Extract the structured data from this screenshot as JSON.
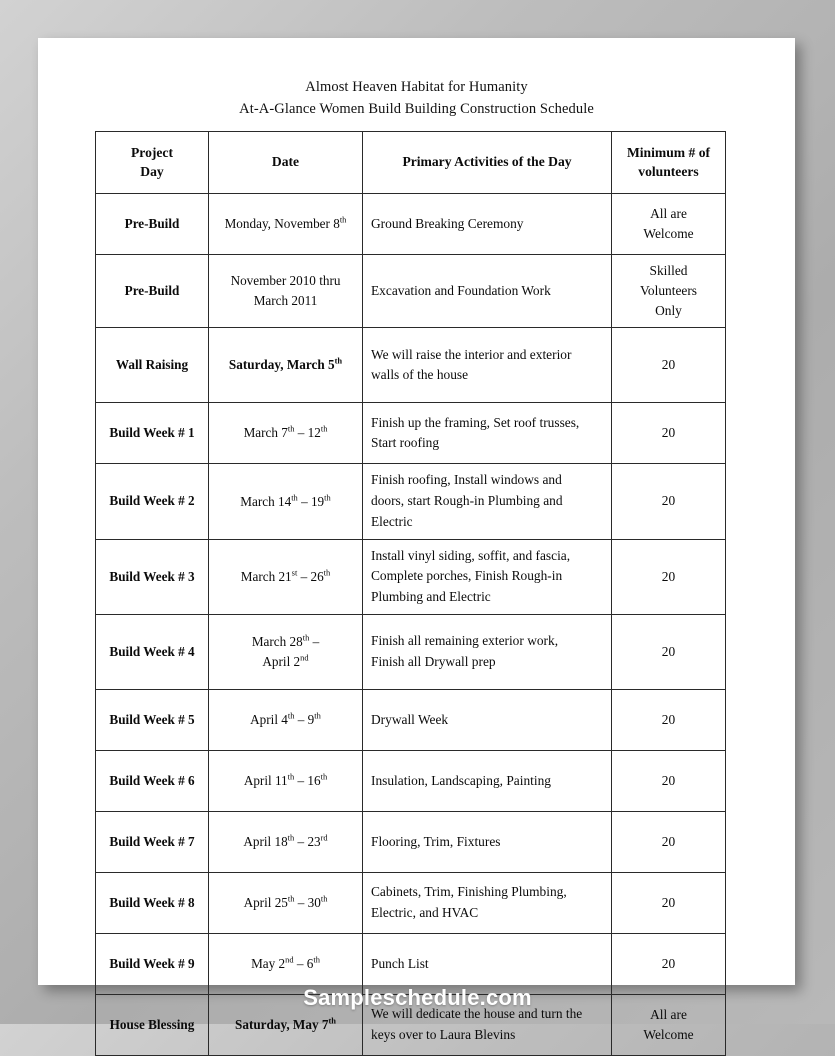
{
  "document": {
    "title_line1": "Almost Heaven Habitat for Humanity",
    "title_line2": "At-A-Glance Women Build Building Construction Schedule"
  },
  "table": {
    "headers": {
      "day": "Project\nDay",
      "day_line1": "Project",
      "day_line2": "Day",
      "date": "Date",
      "activities": "Primary Activities of the Day",
      "volunteers_line1": "Minimum # of",
      "volunteers_line2": "volunteers"
    },
    "rows": [
      {
        "day": "Pre-Build",
        "date_html": "Monday, November 8<sup>th</sup>",
        "date_bold": false,
        "activity_lines": [
          "Ground Breaking Ceremony"
        ],
        "volunteers_lines": [
          "All are",
          "Welcome"
        ]
      },
      {
        "day": "Pre-Build",
        "date_html": "November 2010 thru<br>March 2011",
        "date_bold": false,
        "activity_lines": [
          "Excavation and Foundation Work"
        ],
        "volunteers_lines": [
          "Skilled",
          "Volunteers",
          "Only"
        ]
      },
      {
        "day": "Wall Raising",
        "date_html": "Saturday, March 5<sup>th</sup>",
        "date_bold": true,
        "activity_lines": [
          "We will raise the interior and exterior",
          "walls of the house"
        ],
        "volunteers_lines": [
          "20"
        ]
      },
      {
        "day": "Build Week # 1",
        "date_html": "March 7<sup>th</sup> &ndash; 12<sup>th</sup>",
        "date_bold": false,
        "activity_lines": [
          "Finish up the framing, Set roof trusses,",
          "Start roofing"
        ],
        "volunteers_lines": [
          "20"
        ]
      },
      {
        "day": "Build Week # 2",
        "date_html": "March 14<sup>th</sup> &ndash; 19<sup>th</sup>",
        "date_bold": false,
        "activity_lines": [
          "Finish roofing, Install windows and",
          "doors, start Rough-in Plumbing and",
          "Electric"
        ],
        "volunteers_lines": [
          "20"
        ]
      },
      {
        "day": "Build Week # 3",
        "date_html": "March 21<sup>st</sup> &ndash; 26<sup>th</sup>",
        "date_bold": false,
        "activity_lines": [
          "Install vinyl siding, soffit, and fascia,",
          "Complete porches, Finish Rough-in",
          "Plumbing and Electric"
        ],
        "volunteers_lines": [
          "20"
        ]
      },
      {
        "day": "Build Week # 4",
        "date_html": "March 28<sup>th</sup> &ndash;<br>April 2<sup>nd</sup>",
        "date_bold": false,
        "activity_lines": [
          "Finish all remaining exterior work,",
          "Finish all Drywall prep"
        ],
        "volunteers_lines": [
          "20"
        ]
      },
      {
        "day": "Build Week # 5",
        "date_html": "April 4<sup>th</sup> &ndash; 9<sup>th</sup>",
        "date_bold": false,
        "activity_lines": [
          "Drywall Week"
        ],
        "volunteers_lines": [
          "20"
        ]
      },
      {
        "day": "Build Week # 6",
        "date_html": "April 11<sup>th</sup> &ndash; 16<sup>th</sup>",
        "date_bold": false,
        "activity_lines": [
          "Insulation, Landscaping, Painting"
        ],
        "volunteers_lines": [
          "20"
        ]
      },
      {
        "day": "Build Week # 7",
        "date_html": "April 18<sup>th</sup> &ndash; 23<sup>rd</sup>",
        "date_bold": false,
        "activity_lines": [
          "Flooring, Trim, Fixtures"
        ],
        "volunteers_lines": [
          "20"
        ]
      },
      {
        "day": "Build Week # 8",
        "date_html": "April 25<sup>th</sup> &ndash; 30<sup>th</sup>",
        "date_bold": false,
        "activity_lines": [
          "Cabinets, Trim, Finishing Plumbing,",
          "Electric, and HVAC"
        ],
        "volunteers_lines": [
          "20"
        ]
      },
      {
        "day": "Build Week # 9",
        "date_html": "May 2<sup>nd</sup> &ndash; 6<sup>th</sup>",
        "date_bold": false,
        "activity_lines": [
          "Punch List"
        ],
        "volunteers_lines": [
          "20"
        ]
      },
      {
        "day": "House Blessing",
        "date_html": "Saturday, May 7<sup>th</sup>",
        "date_bold": true,
        "activity_lines": [
          "We will dedicate the house and turn the",
          "keys over to Laura Blevins"
        ],
        "volunteers_lines": [
          "All are",
          "Welcome"
        ]
      }
    ]
  },
  "watermark": {
    "text": "Sampleschedule.com"
  },
  "colors": {
    "page_background": "#ffffff",
    "canvas_background": "#b4b4b4",
    "table_border": "#2a2a2a",
    "text": "#0b0b0b",
    "watermark": "#ffffff"
  }
}
